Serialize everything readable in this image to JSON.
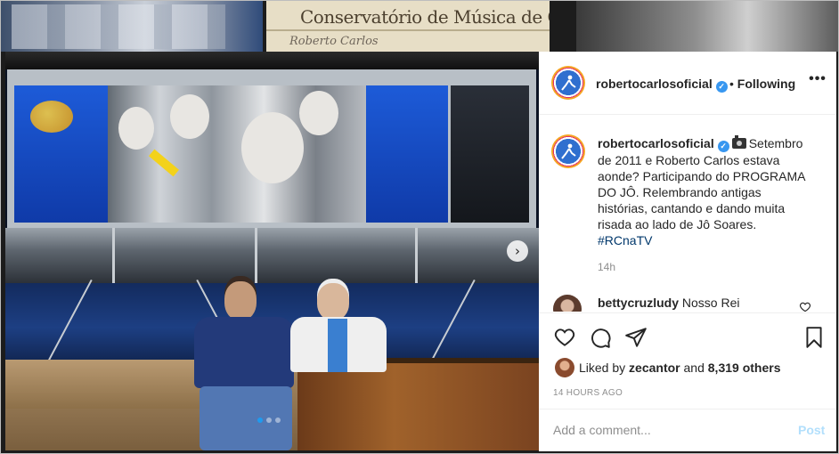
{
  "backdrop": {
    "thumb2_banner": "Conservatório de Música de Cachoeiro de Itape",
    "thumb2_signature": "Roberto Carlos"
  },
  "post": {
    "author": "robertocarlosoficial",
    "verified_mark": "✓",
    "separator": "•",
    "follow_label": "Following",
    "more_icon": "•••",
    "next_icon": "›",
    "carousel": {
      "count": 3,
      "active": 1
    },
    "caption": {
      "author": "robertocarlosoficial",
      "text": "Setembro de 2011 e Roberto Carlos estava aonde? Participando do PROGRAMA DO JÔ. Relembrando antigas histórias, cantando e dando muita risada ao lado de Jô Soares.",
      "hashtag": "#RCnaTV",
      "time": "14h"
    },
    "comments": [
      {
        "user": "bettycruzludy",
        "text": "Nosso Rei"
      }
    ],
    "likes": {
      "prefix": "Liked by",
      "user": "zecantor",
      "and": "and",
      "count": "8,319 others"
    },
    "posted_ago": "14 HOURS AGO",
    "add_comment": {
      "placeholder": "Add a comment...",
      "post_label": "Post"
    },
    "icons": {
      "like": "heart-icon",
      "comment": "comment-icon",
      "share": "paper-plane-icon",
      "save": "bookmark-icon"
    }
  }
}
